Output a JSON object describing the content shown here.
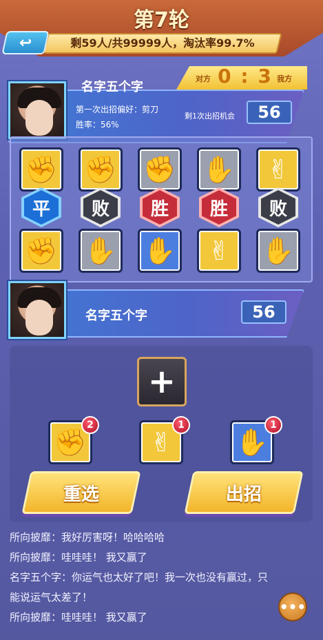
{
  "header": {
    "round_title": "第7轮",
    "stats": "剩59人/共99999人，淘汰率99.7%",
    "back_icon": "back-arrow-icon"
  },
  "opponent": {
    "name": "名字五个字",
    "preference": "第一次出招偏好：剪刀",
    "win_rate": "胜率：56%",
    "chances_label": "剩1次出招机会",
    "count": "56"
  },
  "score": {
    "left_label": "对方",
    "right_label": "我方",
    "value": "0 : 3"
  },
  "battle": {
    "opponent_moves": [
      {
        "hand": "rock",
        "color": "yellow",
        "icon": "rock-icon"
      },
      {
        "hand": "rock",
        "color": "yellow",
        "icon": "rock-icon"
      },
      {
        "hand": "rock",
        "color": "gray",
        "icon": "rock-icon"
      },
      {
        "hand": "paper",
        "color": "gray",
        "icon": "paper-icon"
      },
      {
        "hand": "scissors",
        "color": "yellow",
        "icon": "scissors-icon"
      }
    ],
    "results": [
      "平",
      "败",
      "胜",
      "胜",
      "败"
    ],
    "result_types": [
      "draw",
      "lose",
      "win",
      "win",
      "lose"
    ],
    "my_moves": [
      {
        "hand": "rock",
        "color": "yellow",
        "icon": "rock-icon"
      },
      {
        "hand": "paper",
        "color": "gray",
        "icon": "paper-icon"
      },
      {
        "hand": "paper",
        "color": "blue",
        "icon": "paper-icon"
      },
      {
        "hand": "scissors",
        "color": "yellow",
        "icon": "scissors-icon"
      },
      {
        "hand": "paper",
        "color": "gray",
        "icon": "paper-icon"
      }
    ]
  },
  "me": {
    "name": "名字五个字",
    "count": "56"
  },
  "selection": {
    "plus_icon": "plus-icon",
    "options": [
      {
        "hand": "rock",
        "count": "2",
        "color": "yellow",
        "icon": "rock-icon"
      },
      {
        "hand": "scissors",
        "count": "1",
        "color": "yellow",
        "icon": "scissors-icon"
      },
      {
        "hand": "paper",
        "count": "1",
        "color": "blue",
        "icon": "paper-icon"
      }
    ],
    "reset_label": "重选",
    "play_label": "出招"
  },
  "chat": {
    "lines": [
      "所向披靡：我好厉害呀！哈哈哈哈",
      "所向披靡：哇哇哇！ 我又赢了",
      "名字五个字：你运气也太好了吧！我一次也没有赢过，只",
      "能说运气太差了！",
      "所向披靡：哇哇哇！ 我又赢了"
    ],
    "chat_icon": "chat-bubble-icon"
  }
}
